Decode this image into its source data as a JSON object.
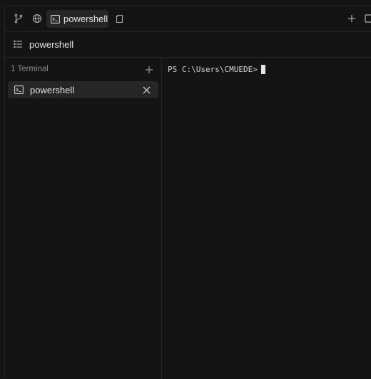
{
  "topbar": {
    "icons": {
      "source_control": "git-branch-icon",
      "globe": "globe-icon",
      "terminal": "terminal-icon",
      "copy": "copy-icon",
      "add": "plus-icon",
      "maximize": "square-icon"
    },
    "active_tab_label": "powershell"
  },
  "subbar": {
    "icon": "list-icon",
    "title": "powershell"
  },
  "sidebar": {
    "header": "1 Terminal",
    "items": [
      {
        "label": "powershell",
        "icon": "terminal-icon"
      }
    ]
  },
  "terminal": {
    "prompt": "PS C:\\Users\\CMUEDE>"
  },
  "colors": {
    "background": "#141414",
    "active_tab": "#262626",
    "border": "#262626",
    "text": "#e2e2e2",
    "muted": "#8a8a8a"
  }
}
